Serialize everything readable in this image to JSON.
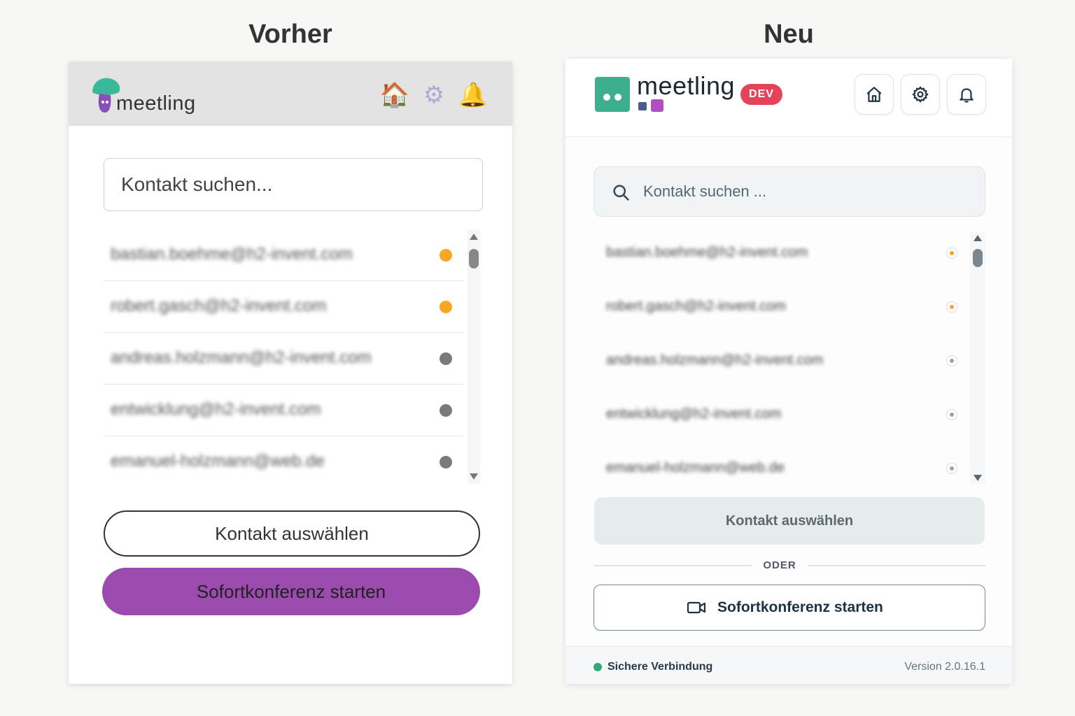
{
  "titles": {
    "before": "Vorher",
    "after": "Neu"
  },
  "before": {
    "brand": "meetling",
    "header_icons": [
      {
        "name": "home-icon",
        "glyph": "🏠"
      },
      {
        "name": "gear-icon",
        "glyph": "⚙"
      },
      {
        "name": "bell-icon",
        "glyph": "🔔"
      }
    ],
    "search_placeholder": "Kontakt suchen...",
    "contacts": [
      {
        "email": "bastian.boehme@h2-invent.com",
        "status_color": "#f5a623"
      },
      {
        "email": "robert.gasch@h2-invent.com",
        "status_color": "#f5a623"
      },
      {
        "email": "andreas.holzmann@h2-invent.com",
        "status_color": "#7a7a7a"
      },
      {
        "email": "entwicklung@h2-invent.com",
        "status_color": "#7a7a7a"
      },
      {
        "email": "emanuel-holzmann@web.de",
        "status_color": "#7a7a7a"
      }
    ],
    "select_button": "Kontakt auswählen",
    "conference_button": "Sofortkonferenz starten"
  },
  "after": {
    "brand": "meetling",
    "badge": "DEV",
    "search_placeholder": "Kontakt suchen ...",
    "contacts": [
      {
        "email": "bastian.boehme@h2-invent.com",
        "status_color": "#f5a623"
      },
      {
        "email": "robert.gasch@h2-invent.com",
        "status_color": "#f5a623"
      },
      {
        "email": "andreas.holzmann@h2-invent.com",
        "status_color": "#9aa3a8"
      },
      {
        "email": "entwicklung@h2-invent.com",
        "status_color": "#9aa3a8"
      },
      {
        "email": "emanuel-holzmann@web.de",
        "status_color": "#9aa3a8"
      }
    ],
    "select_button": "Kontakt auswählen",
    "divider": "ODER",
    "conference_button": "Sofortkonferenz starten",
    "footer": {
      "status": "Sichere Verbindung",
      "version": "Version 2.0.16.1"
    }
  }
}
